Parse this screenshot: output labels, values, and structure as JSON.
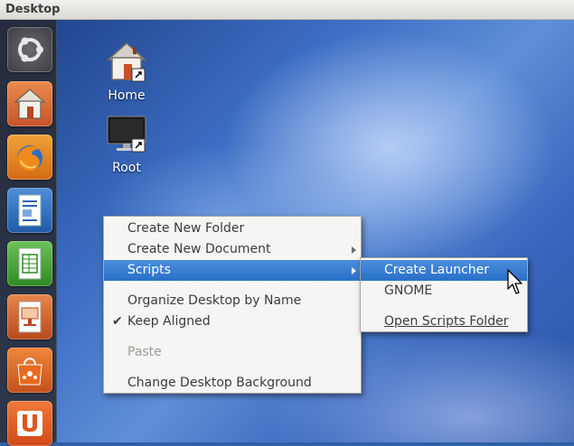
{
  "topbar": {
    "title": "Desktop"
  },
  "desktop_icons": [
    {
      "label": "Home"
    },
    {
      "label": "Root"
    }
  ],
  "launcher": {
    "items": [
      "ubuntu-logo-icon",
      "home-folder-icon",
      "firefox-icon",
      "writer-icon",
      "calc-icon",
      "impress-icon",
      "software-center-icon",
      "ubuntu-one-icon"
    ]
  },
  "context_menu": {
    "items": [
      {
        "label": "Create New Folder"
      },
      {
        "label": "Create New Document",
        "submenu": true
      },
      {
        "label": "Scripts",
        "submenu": true,
        "highlighted": true
      },
      {
        "label": "Organize Desktop by Name"
      },
      {
        "label": "Keep Aligned",
        "checked": true
      },
      {
        "label": "Paste",
        "disabled": true
      },
      {
        "label": "Change Desktop Background"
      }
    ]
  },
  "scripts_submenu": {
    "items": [
      {
        "label": "Create Launcher",
        "highlighted": true
      },
      {
        "label": "GNOME"
      },
      {
        "label": "Open Scripts Folder"
      }
    ]
  },
  "colors": {
    "highlight": "#2f76cc",
    "launcher_bg": "#2c2c30",
    "menu_bg": "#f6f5f4"
  }
}
